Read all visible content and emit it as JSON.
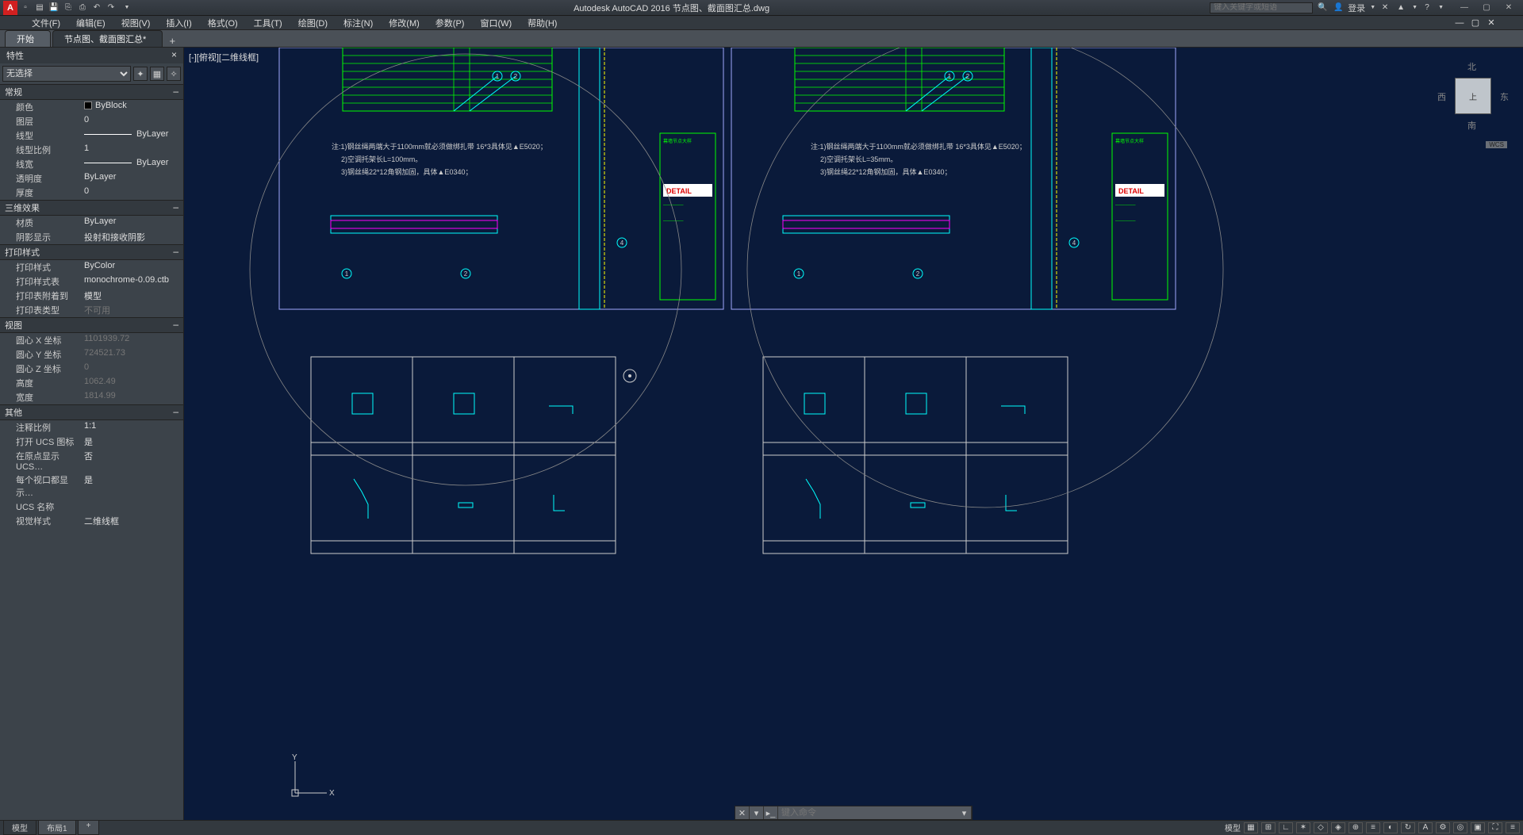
{
  "titlebar": {
    "app_title": "Autodesk AutoCAD 2016   节点图、截面图汇总.dwg",
    "search_placeholder": "键入关键字或短语",
    "login_label": "登录"
  },
  "menubar": {
    "items": [
      "文件(F)",
      "编辑(E)",
      "视图(V)",
      "插入(I)",
      "格式(O)",
      "工具(T)",
      "绘图(D)",
      "标注(N)",
      "修改(M)",
      "参数(P)",
      "窗口(W)",
      "帮助(H)"
    ]
  },
  "tabs": {
    "start": "开始",
    "file1": "节点图、截面图汇总*"
  },
  "properties": {
    "panel_title": "特性",
    "selector": "无选择",
    "categories": {
      "general": {
        "title": "常规",
        "color_label": "颜色",
        "color_value": "ByBlock",
        "layer_label": "图层",
        "layer_value": "0",
        "linetype_label": "线型",
        "linetype_value": "ByLayer",
        "ltscale_label": "线型比例",
        "ltscale_value": "1",
        "lineweight_label": "线宽",
        "lineweight_value": "ByLayer",
        "transp_label": "透明度",
        "transp_value": "ByLayer",
        "thickness_label": "厚度",
        "thickness_value": "0"
      },
      "effects3d": {
        "title": "三维效果",
        "material_label": "材质",
        "material_value": "ByLayer",
        "shadow_label": "阴影显示",
        "shadow_value": "投射和接收阴影"
      },
      "plot": {
        "title": "打印样式",
        "ps_label": "打印样式",
        "ps_value": "ByColor",
        "pst_label": "打印样式表",
        "pst_value": "monochrome-0.09.ctb",
        "psa_label": "打印表附着到",
        "psa_value": "模型",
        "ptt_label": "打印表类型",
        "ptt_value": "不可用"
      },
      "view": {
        "title": "视图",
        "cx_label": "圆心 X 坐标",
        "cx_value": "1101939.72",
        "cy_label": "圆心 Y 坐标",
        "cy_value": "724521.73",
        "cz_label": "圆心 Z 坐标",
        "cz_value": "0",
        "h_label": "高度",
        "h_value": "1062.49",
        "w_label": "宽度",
        "w_value": "1814.99"
      },
      "misc": {
        "title": "其他",
        "ann_label": "注释比例",
        "ann_value": "1:1",
        "ucs_icon_label": "打开 UCS 图标",
        "ucs_icon_value": "是",
        "ucs_origin_label": "在原点显示 UCS…",
        "ucs_origin_value": "否",
        "vp_ucs_label": "每个视口都显示…",
        "vp_ucs_value": "是",
        "ucs_name_label": "UCS 名称",
        "ucs_name_value": "",
        "vs_label": "视觉样式",
        "vs_value": "二维线框"
      }
    }
  },
  "canvas": {
    "viewport_label": "[-][俯视][二维线框]",
    "viewcube": {
      "top": "上",
      "north": "北",
      "south": "南",
      "west": "西",
      "east": "东",
      "wcs": "WCS"
    },
    "ucs": {
      "x": "X",
      "y": "Y"
    },
    "cmdline_placeholder": "键入命令",
    "notes": {
      "left": [
        "注:1)钢丝绳两端大于1100mm就必须做绑扎带 16*3具体见▲E5020；",
        "2)空调托架长L=100mm。",
        "3)钢丝绳22*12角钢加固，具体▲E0340；"
      ],
      "right": [
        "注:1)钢丝绳两端大于1100mm就必须做绑扎带 16*3具体见▲E5020；",
        "2)空调托架长L=35mm。",
        "3)钢丝绳22*12角钢加固，具体▲E0340；"
      ]
    },
    "detail_brand": "DETAIL"
  },
  "statusbar": {
    "model_tab": "模型",
    "layout1_tab": "布局1",
    "model_label": "模型"
  }
}
